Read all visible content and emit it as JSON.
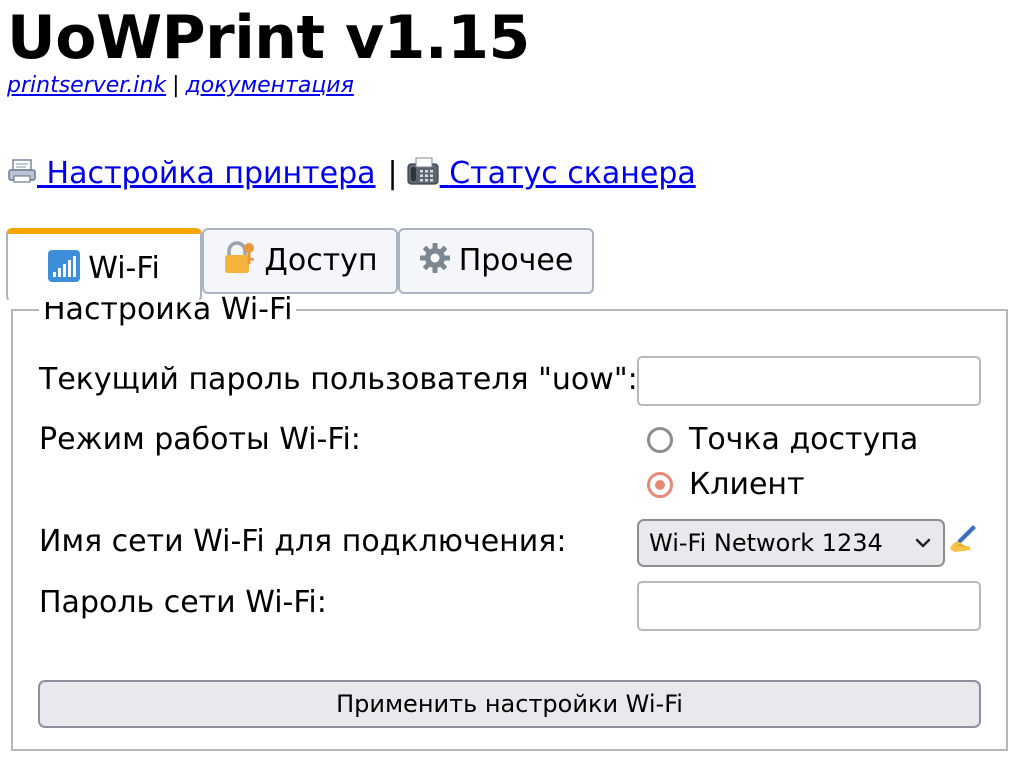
{
  "header": {
    "title": "UoWPrint v1.15",
    "links": {
      "site": "printserver.ink",
      "separator": "|",
      "docs": "документация"
    }
  },
  "nav": {
    "printer_settings": "Настройка принтера",
    "separator": "|",
    "scanner_status": "Статус сканера"
  },
  "tabs": [
    {
      "label": "Wi-Fi",
      "icon": "signal-bars-icon",
      "active": true
    },
    {
      "label": "Доступ",
      "icon": "lock-with-key-icon",
      "active": false
    },
    {
      "label": "Прочее",
      "icon": "gear-icon",
      "active": false
    }
  ],
  "wifi_settings": {
    "legend": "Настройка Wi-Fi",
    "current_password_label": "Текущий пароль пользователя \"uow\":",
    "current_password_value": "",
    "mode_label": "Режим работы Wi-Fi:",
    "mode_options": [
      {
        "label": "Точка доступа",
        "checked": false
      },
      {
        "label": "Клиент",
        "checked": true
      }
    ],
    "network_name_label": "Имя сети Wi-Fi для подключения:",
    "network_selected": "Wi-Fi Network 1234",
    "network_password_label": "Пароль сети Wi-Fi:",
    "network_password_value": "",
    "apply_button": "Применить настройки Wi-Fi"
  },
  "colors": {
    "link": "#0000ee",
    "active_tab_accent": "#f7a600",
    "radio_checked": "#e48b75"
  }
}
